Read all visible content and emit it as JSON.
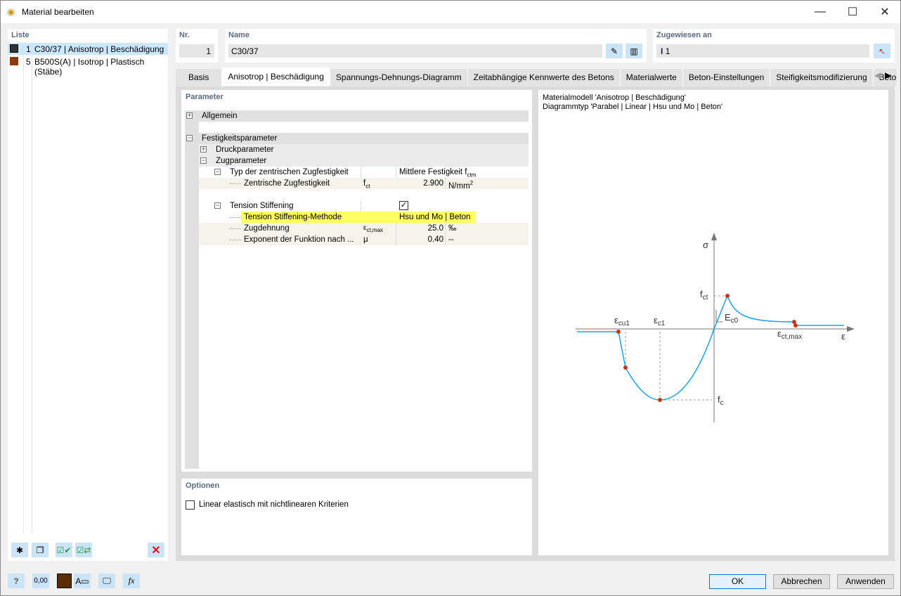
{
  "window": {
    "title": "Material bearbeiten",
    "icon": "material-icon"
  },
  "list": {
    "header": "Liste",
    "items": [
      {
        "num": "1",
        "label": "C30/37 | Anisotrop | Beschädigung",
        "color": "#333333",
        "selected": true
      },
      {
        "num": "5",
        "label": "B500S(A) | Isotrop | Plastisch (Stäbe)",
        "color": "#8b3a0f",
        "selected": false
      }
    ]
  },
  "nr": {
    "header": "Nr.",
    "value": "1"
  },
  "name": {
    "header": "Name",
    "value": "C30/37"
  },
  "assigned": {
    "header": "Zugewiesen an",
    "value": "1"
  },
  "tabs": [
    "Basis",
    "Anisotrop | Beschädigung",
    "Spannungs-Dehnungs-Diagramm",
    "Zeitabhängige Kennwerte des Betons",
    "Materialwerte",
    "Beton-Einstellungen",
    "Steifigkeitsmodifizierung",
    "Beto"
  ],
  "active_tab": 1,
  "parameter": {
    "header": "Parameter",
    "allgemein": "Allgemein",
    "festigkeit": "Festigkeitsparameter",
    "druck": "Druckparameter",
    "zug": "Zugparameter",
    "typ": {
      "label": "Typ der zentrischen Zugfestigkeit",
      "value": "Mittlere Festigkeit f",
      "value_sub": "ctm"
    },
    "zentrisch": {
      "label": "Zentrische Zugfestigkeit",
      "sym": "f",
      "sym_sub": "ct",
      "value": "2.900",
      "unit": "N/mm",
      "unit_sup": "2"
    },
    "ts": {
      "label": "Tension Stiffening",
      "checked": true
    },
    "tsm": {
      "label": "Tension Stiffening-Methode",
      "value": "Hsu und Mo | Beton",
      "highlight": "#ffff66"
    },
    "zugdehnung": {
      "label": "Zugdehnung",
      "sym": "ε",
      "sym_sub": "ct,max",
      "value": "25.0",
      "unit": "‰"
    },
    "exponent": {
      "label": "Exponent der Funktion nach ...",
      "sym": "μ",
      "value": "0.40",
      "unit": "--"
    }
  },
  "options": {
    "header": "Optionen",
    "linear": {
      "label": "Linear elastisch mit nichtlinearen Kriterien",
      "checked": false
    }
  },
  "diagram": {
    "line1": "Materialmodell 'Anisotrop | Beschädigung'",
    "line2": "Diagrammtyp 'Parabel | Linear | Hsu und Mo | Beton'",
    "sigma": "σ",
    "eps": "ε",
    "fct": "f",
    "fct_sub": "ct",
    "fc": "f",
    "fc_sub": "c",
    "ec0": "E",
    "ec0_sub": "c0",
    "ecu1": "ε",
    "ecu1_sub": "cu1",
    "ec1": "ε",
    "ec1_sub": "c1",
    "ectmax": "ε",
    "ectmax_sub": "ct,max",
    "curve_color": "#1ba1e2",
    "point_color": "#c0391b"
  },
  "buttons": {
    "ok": "OK",
    "cancel": "Abbrechen",
    "apply": "Anwenden"
  },
  "bottom_icons": [
    "help-icon",
    "units-icon",
    "color-swatch",
    "display-properties-icon",
    "view-icon",
    "formula-icon"
  ],
  "list_icons": [
    "new-material-icon",
    "copy-material-icon",
    "check-all-icon",
    "check-swap-icon",
    "delete-icon"
  ]
}
